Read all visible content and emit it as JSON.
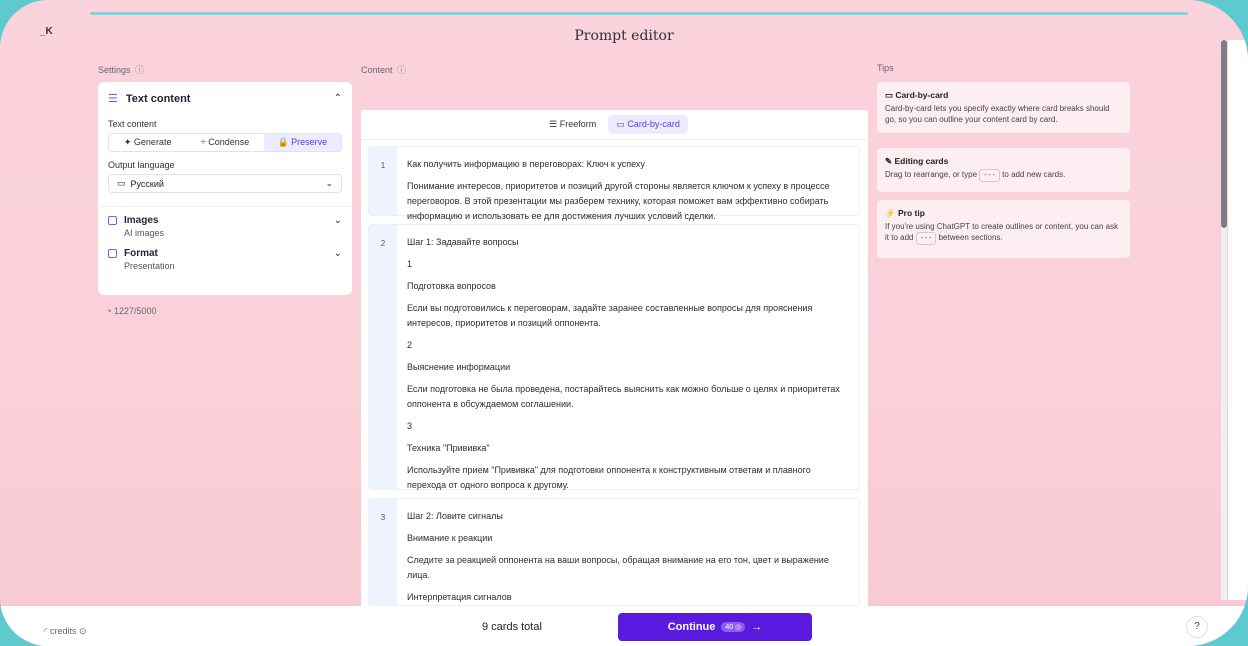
{
  "app": {
    "title": "Prompt editor",
    "collapse_label": "_K"
  },
  "sections": {
    "settings": "Settings",
    "content": "Content",
    "tips": "Tips",
    "info_icon": "ⓘ"
  },
  "settings": {
    "text_content_title": "Text content",
    "text_content_label": "Text content",
    "modes": [
      "Generate",
      "Condense",
      "Preserve"
    ],
    "active_mode": "Preserve",
    "output_language_label": "Output language",
    "output_language_value": "Русский",
    "images_title": "Images",
    "images_desc": "AI images",
    "format_title": "Format",
    "format_desc": "Presentation",
    "char_count": "1227/5000"
  },
  "content": {
    "modes": [
      "Freeform",
      "Card-by-card"
    ],
    "active_mode": "Card-by-card",
    "cards": [
      {
        "num": "1",
        "lines": [
          "Как получить информацию в переговорах: Ключ к успеху",
          "Понимание интересов, приоритетов и позиций другой стороны является ключом к успеху в процессе переговоров. В этой презентации мы разберем технику, которая поможет вам эффективно собирать информацию и использовать ее для достижения лучших условий сделки."
        ]
      },
      {
        "num": "2",
        "lines": [
          "Шаг 1: Задавайте вопросы",
          "1",
          "Подготовка вопросов",
          "Если вы подготовились к переговорам, задайте заранее составленные вопросы для прояснения интересов, приоритетов и позиций оппонента.",
          "2",
          "Выяснение информации",
          "Если подготовка не была проведена, постарайтесь выяснить как можно больше о целях и приоритетах оппонента в обсуждаемом соглашении.",
          "3",
          "Техника \"Прививка\"",
          "Используйте прием \"Прививка\" для подготовки оппонента к конструктивным ответам и плавного перехода от одного вопроса к другому."
        ]
      },
      {
        "num": "3",
        "lines": [
          "Шаг 2: Ловите сигналы",
          "Внимание к реакции",
          "Следите за реакцией оппонента на ваши вопросы, обращая внимание на его тон, цвет и выражение лица.",
          "Интерпретация сигналов"
        ]
      }
    ]
  },
  "tips": [
    {
      "title": "Card-by-card",
      "text": "Card-by-card lets you specify exactly where card breaks should go, so you can outline your content card by card."
    },
    {
      "title": "Editing cards",
      "text_before": "Drag to rearrange, or type",
      "code": "---",
      "text_after": "to add new cards."
    },
    {
      "title": "Pro tip",
      "text_before": "If you're using ChatGPT to create outlines or content, you can ask it to add",
      "code": "---",
      "text_after": "between sections."
    }
  ],
  "footer": {
    "credits": "credits",
    "cards_total": "9 cards total",
    "continue_label": "Continue",
    "continue_cost": "40",
    "help": "?"
  },
  "colors": {
    "accent": "#5b1ae0",
    "accent_light": "#ecebff",
    "background": "#fbd3dc"
  }
}
